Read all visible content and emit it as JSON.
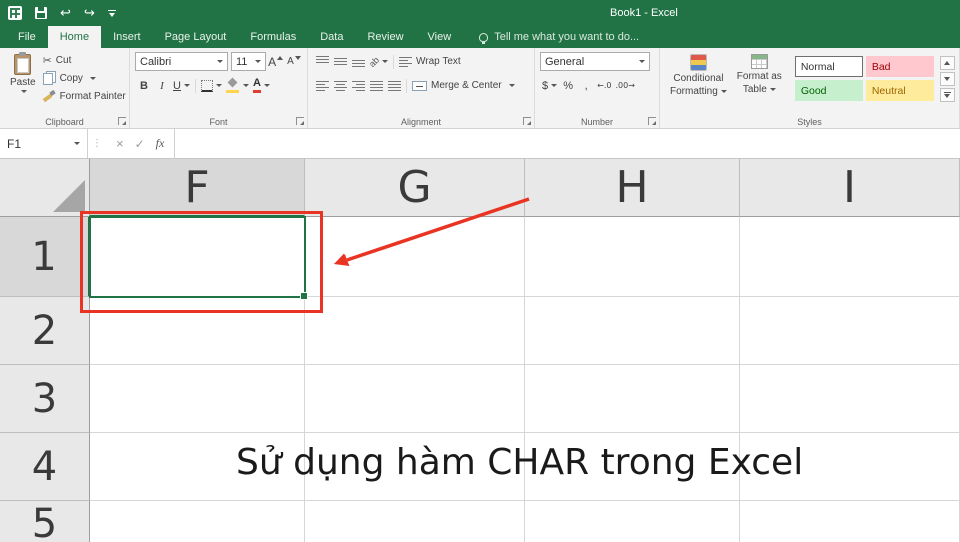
{
  "colors": {
    "excel_green": "#217346",
    "annotation_red": "#ea3423",
    "style_bad_bg": "#ffc7ce",
    "style_bad_text": "#9c0006",
    "style_good_bg": "#c6efce",
    "style_good_text": "#006100",
    "style_neutral_bg": "#ffeb9c",
    "style_neutral_text": "#9c6500"
  },
  "title_bar": {
    "title": "Book1 - Excel"
  },
  "tabs": {
    "file": "File",
    "home": "Home",
    "insert": "Insert",
    "page_layout": "Page Layout",
    "formulas": "Formulas",
    "data": "Data",
    "review": "Review",
    "view": "View",
    "tell_me": "Tell me what you want to do..."
  },
  "ribbon": {
    "clipboard": {
      "label": "Clipboard",
      "paste": "Paste",
      "cut": "Cut",
      "copy": "Copy",
      "format_painter": "Format Painter"
    },
    "font": {
      "label": "Font",
      "font_name": "Calibri",
      "font_size": "11",
      "bold": "B",
      "italic": "I",
      "underline": "U"
    },
    "alignment": {
      "label": "Alignment",
      "wrap_text": "Wrap Text",
      "merge_center": "Merge & Center"
    },
    "number": {
      "label": "Number",
      "format": "General",
      "currency": "$",
      "percent": "%",
      "comma": ",",
      "increase_decimal": "←.0",
      "decrease_decimal": ".00→"
    },
    "styles": {
      "label": "Styles",
      "conditional_formatting_line1": "Conditional",
      "conditional_formatting_line2": "Formatting",
      "format_as_table_line1": "Format as",
      "format_as_table_line2": "Table",
      "cell_styles": [
        {
          "label": "Normal"
        },
        {
          "label": "Bad"
        },
        {
          "label": "Good"
        },
        {
          "label": "Neutral"
        }
      ]
    }
  },
  "formula_bar": {
    "name_box": "F1",
    "dots": "⋮",
    "cancel": "×",
    "enter": "✓",
    "insert_function": "fx",
    "formula_value": ""
  },
  "grid": {
    "selected_cell": "F1",
    "columns": [
      "F",
      "G",
      "H",
      "I"
    ],
    "rows": [
      "1",
      "2",
      "3",
      "4",
      "5"
    ],
    "cells": {
      "F4": "Sử dụng hàm CHAR trong Excel"
    }
  },
  "glyphs": {
    "cut": "✂",
    "undo": "↩",
    "redo": "↪",
    "grow_font": "A",
    "shrink_font": "A",
    "font_color": "A",
    "orientation": "ab"
  }
}
